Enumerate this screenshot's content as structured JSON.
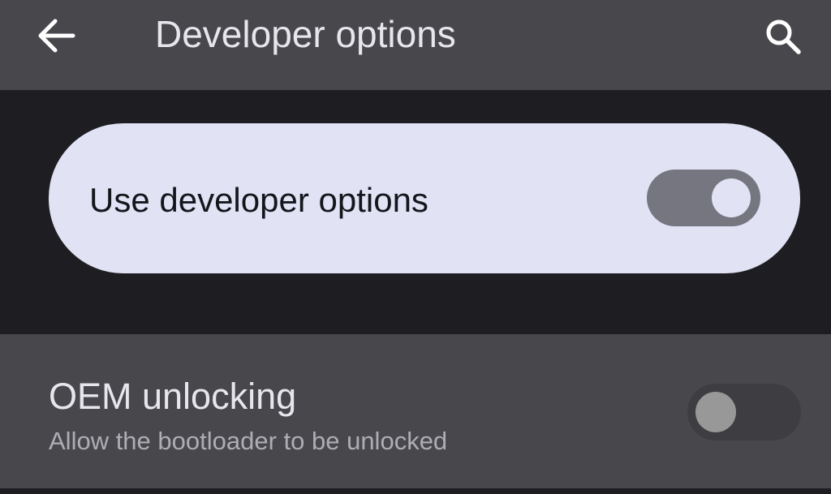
{
  "app_bar": {
    "title": "Developer options",
    "back_icon": "arrow-back-icon",
    "search_icon": "search-icon",
    "background": "#48484c"
  },
  "main_switch": {
    "label": "Use developer options",
    "checked": true,
    "card_color": "#e1e3f5",
    "track_color": "#767680"
  },
  "settings": [
    {
      "title": "OEM unlocking",
      "summary": "Allow the bootloader to be unlocked",
      "checked": false,
      "enabled": false
    }
  ],
  "colors": {
    "background": "#1e1e22",
    "text_primary": "#e7e6ec",
    "text_secondary": "#aeadb4"
  }
}
